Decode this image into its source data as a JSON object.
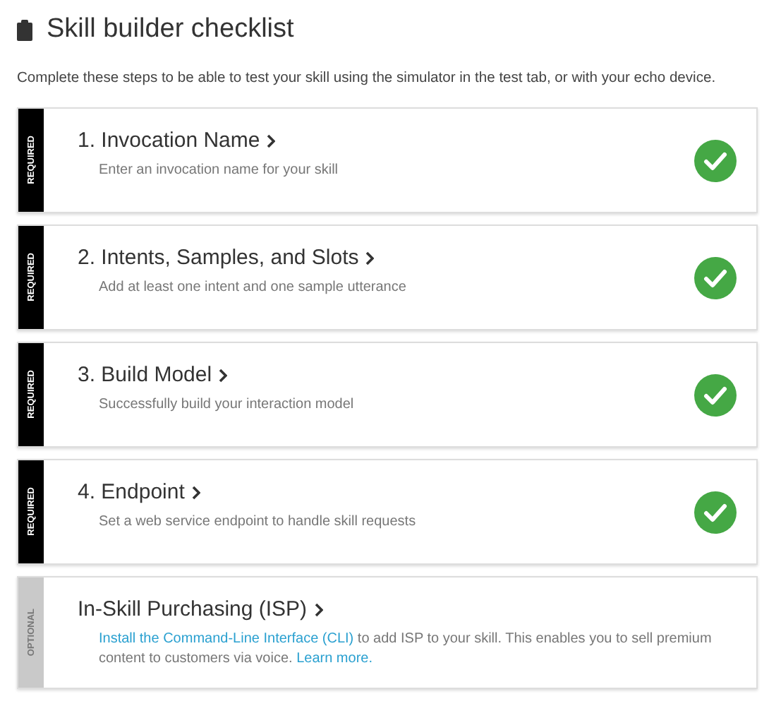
{
  "title": "Skill builder checklist",
  "intro": "Complete these steps to be able to test your skill using the simulator in the test tab, or with your echo device.",
  "steps": [
    {
      "kind": "required",
      "tag": "REQUIRED",
      "title": "1. Invocation Name",
      "completed": true,
      "description": [
        {
          "kind": "text",
          "text": "Enter an invocation name for your skill"
        }
      ]
    },
    {
      "kind": "required",
      "tag": "REQUIRED",
      "title": "2. Intents, Samples, and Slots",
      "completed": true,
      "description": [
        {
          "kind": "text",
          "text": "Add at least one intent and one sample utterance"
        }
      ]
    },
    {
      "kind": "required",
      "tag": "REQUIRED",
      "title": "3. Build Model",
      "completed": true,
      "description": [
        {
          "kind": "text",
          "text": "Successfully build your interaction model"
        }
      ]
    },
    {
      "kind": "required",
      "tag": "REQUIRED",
      "title": "4. Endpoint",
      "completed": true,
      "description": [
        {
          "kind": "text",
          "text": "Set a web service endpoint to handle skill requests"
        }
      ]
    },
    {
      "kind": "optional",
      "tag": "OPTIONAL",
      "title": "In-Skill Purchasing (ISP)",
      "completed": false,
      "description": [
        {
          "kind": "link",
          "text": "Install the Command-Line Interface (CLI)"
        },
        {
          "kind": "text",
          "text": " to add ISP to your skill. This enables you to sell premium content to customers via voice. "
        },
        {
          "kind": "link",
          "text": "Learn more."
        }
      ]
    }
  ]
}
